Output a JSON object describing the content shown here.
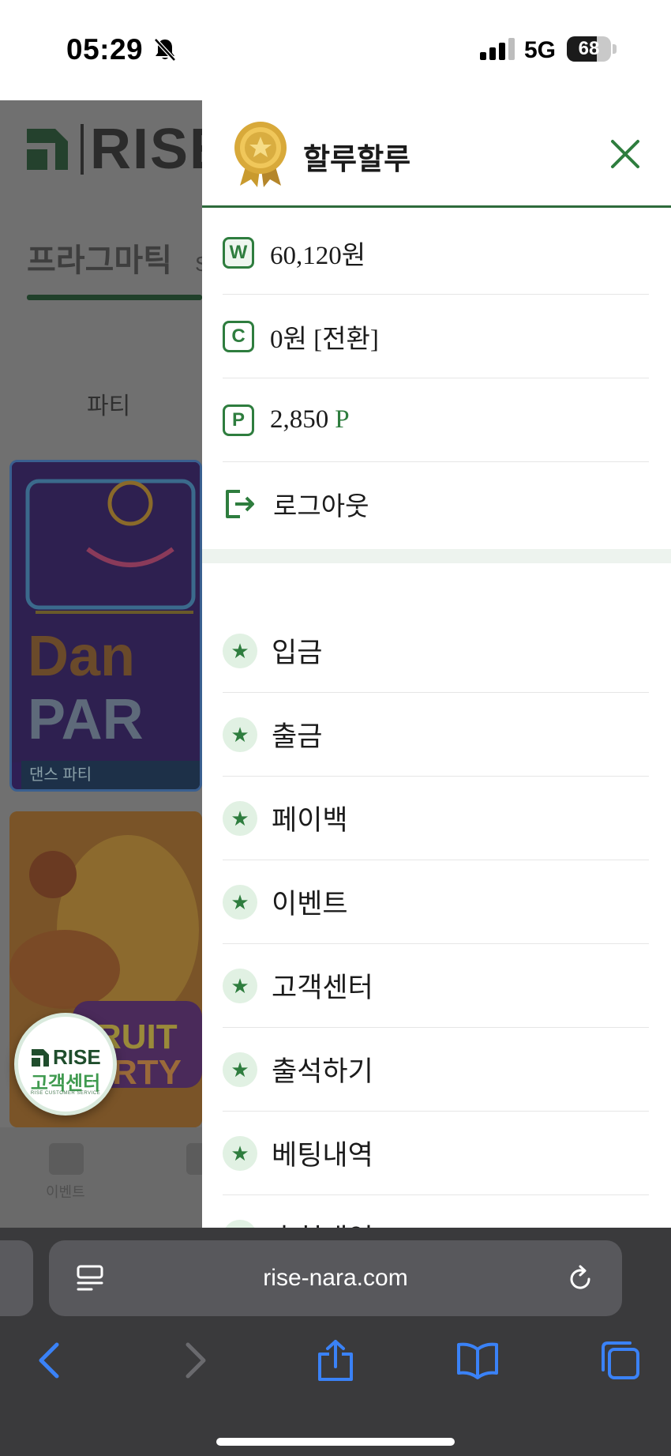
{
  "status_bar": {
    "time": "05:29",
    "network": "5G",
    "battery_percent": "68"
  },
  "background_page": {
    "brand": "RISE",
    "provider_tab": "프라그마틱",
    "provider_tab_suffix": "S",
    "category": "파티",
    "game_caption": "댄스 파티",
    "nav_label": "이벤트"
  },
  "support_badge": {
    "brand": "RISE",
    "title": "고객센터",
    "subtitle": "RISE CUSTOMER SERVICE"
  },
  "drawer": {
    "username": "할루할루",
    "balances": [
      {
        "icon": "W",
        "text": "60,120원"
      },
      {
        "icon": "C",
        "text": "0원 [전환]"
      },
      {
        "icon": "P",
        "text": "2,850",
        "unit": "P"
      }
    ],
    "logout_label": "로그아웃",
    "menu": [
      {
        "label": "입금"
      },
      {
        "label": "출금"
      },
      {
        "label": "페이백"
      },
      {
        "label": "이벤트"
      },
      {
        "label": "고객센터"
      },
      {
        "label": "출석하기"
      },
      {
        "label": "베팅내역"
      },
      {
        "label": "추천내역"
      }
    ]
  },
  "browser": {
    "url": "rise-nara.com"
  },
  "colors": {
    "accent_green": "#2e7d3e",
    "header_border": "#2e6b3c",
    "overlay_dim": "#707070",
    "safari_bar": "#3a3a3c",
    "safari_icon_blue": "#3a82f7"
  }
}
